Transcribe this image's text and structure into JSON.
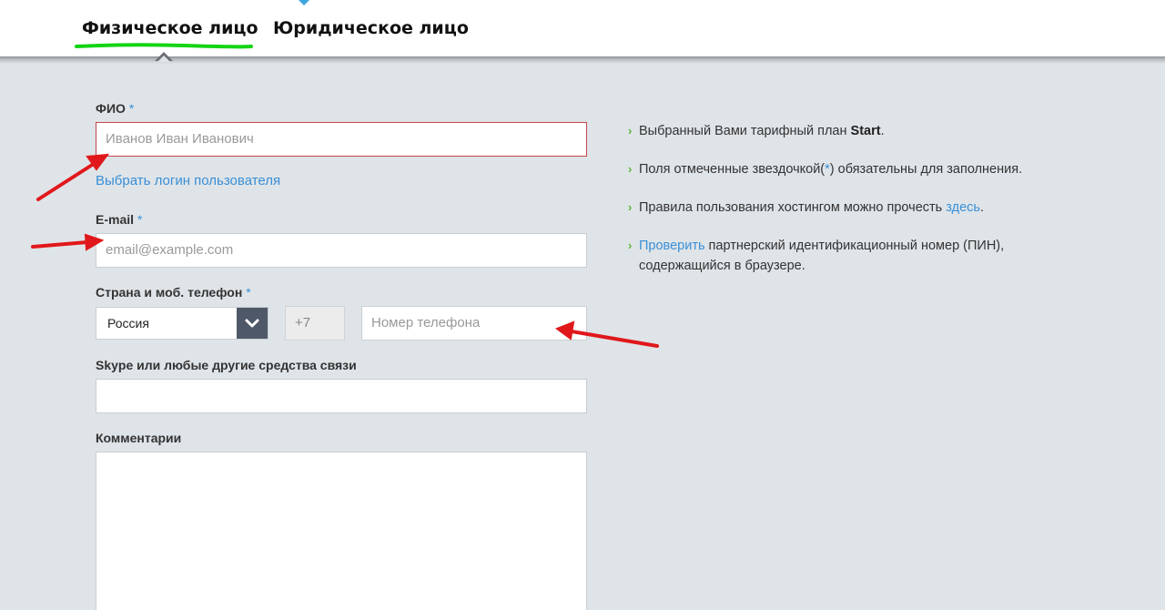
{
  "tabs": {
    "individual": "Физическое лицо",
    "legal": "Юридическое лицо"
  },
  "form": {
    "fio_label": "ФИО",
    "fio_required": "*",
    "fio_placeholder": "Иванов Иван Иванович",
    "choose_login_link": "Выбрать логин пользователя",
    "email_label": "E-mail",
    "email_required": "*",
    "email_placeholder": "email@example.com",
    "phone_label": "Страна и моб. телефон",
    "phone_required": "*",
    "country_value": "Россия",
    "phone_code": "+7",
    "phone_placeholder": "Номер телефона",
    "skype_label": "Skype или любые другие средства связи",
    "comments_label": "Комментарии"
  },
  "info": {
    "item1_text": "Выбранный Вами тарифный план ",
    "item1_plan": "Start",
    "item1_end": ".",
    "item2_start": "Поля отмеченные звездочкой(",
    "item2_star": "*",
    "item2_end": ") обязательны для заполнения.",
    "item3_text": "Правила пользования хостингом можно прочесть ",
    "item3_link": "здесь",
    "item3_end": ".",
    "item4_link": "Проверить",
    "item4_text": " партнерский идентификационный номер (ПИН),",
    "item4_text2": "содержащийся в браузере."
  },
  "colors": {
    "accent_link": "#3a8fd6",
    "chevron": "#5bb534",
    "error_border": "#c4474d",
    "tab_underline": "#14d414",
    "annotation_arrow": "#e0181b"
  }
}
